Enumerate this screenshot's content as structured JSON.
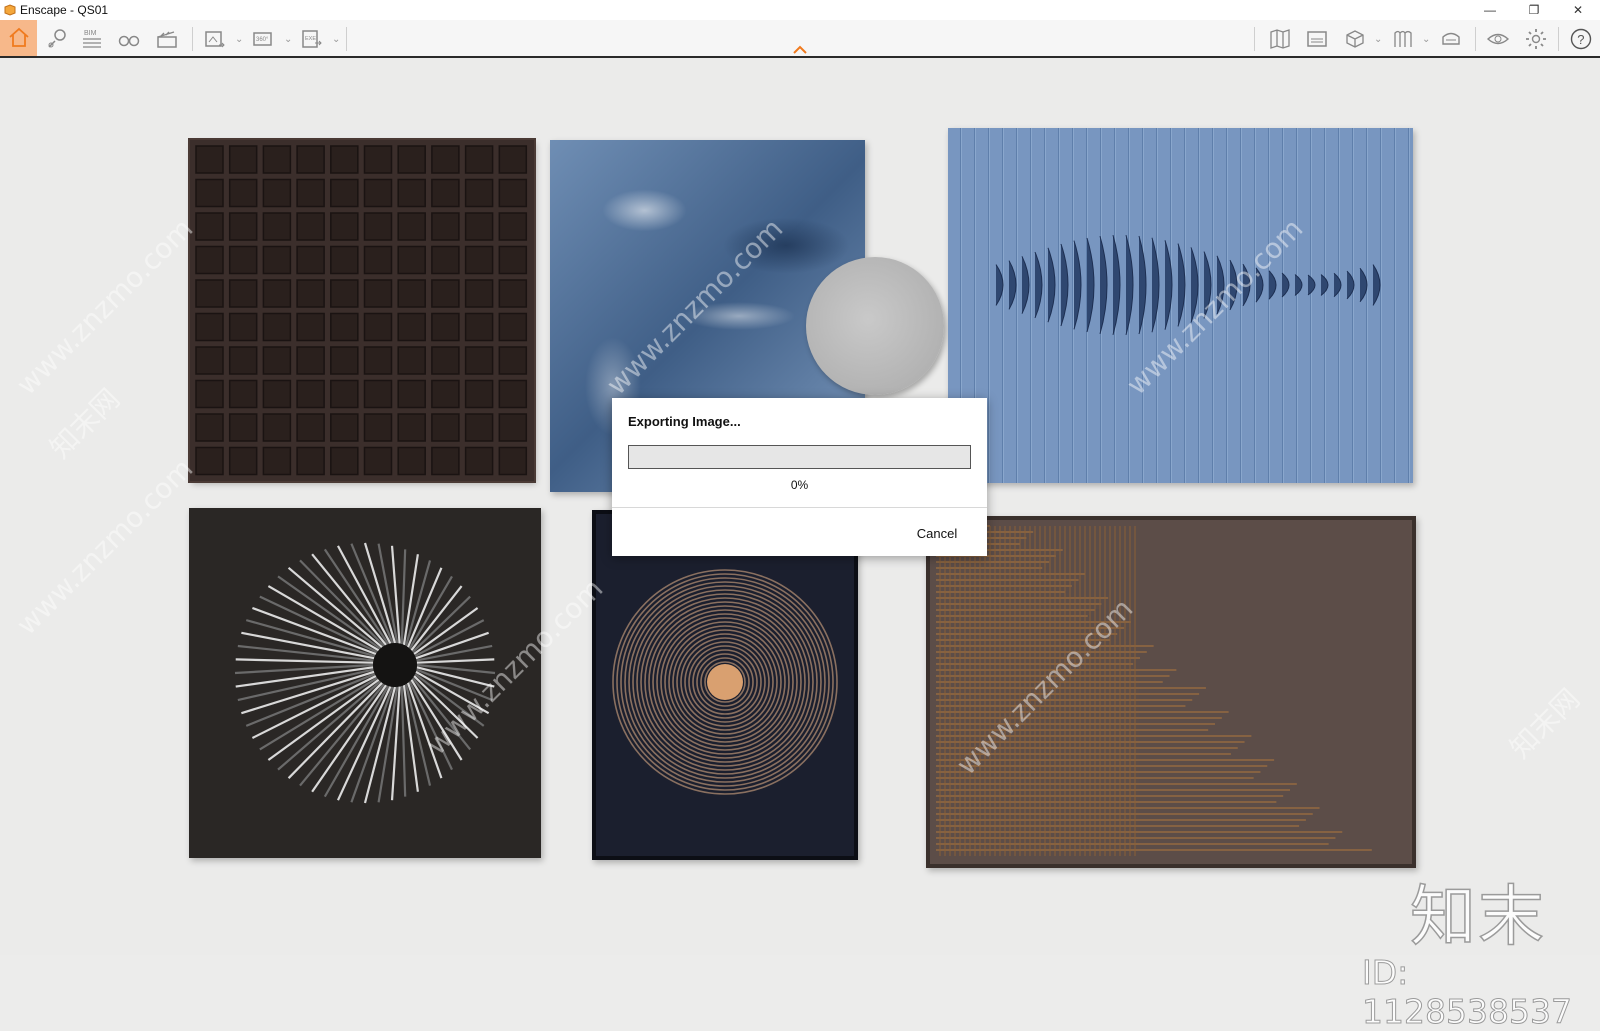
{
  "window": {
    "title": "Enscape - QS01"
  },
  "window_controls": {
    "minimize": "—",
    "restore": "❐",
    "close": "✕"
  },
  "toolbar": {
    "left": [
      {
        "name": "home-icon",
        "active": true
      },
      {
        "name": "views-icon"
      },
      {
        "name": "bim-icon",
        "label": "BIM"
      },
      {
        "name": "binoculars-icon"
      },
      {
        "name": "clapperboard-icon"
      },
      {
        "name": "render-image-icon",
        "dropdown": true
      },
      {
        "name": "panorama-360-icon",
        "label": "360°",
        "dropdown": true
      },
      {
        "name": "export-exe-icon",
        "label": "EXE",
        "dropdown": true
      }
    ],
    "right": [
      {
        "name": "map-icon"
      },
      {
        "name": "atmosphere-icon"
      },
      {
        "name": "cube-icon",
        "dropdown": true
      },
      {
        "name": "asset-library-icon",
        "dropdown": true
      },
      {
        "name": "vr-headset-icon"
      },
      {
        "name": "eye-icon"
      },
      {
        "name": "settings-gear-icon"
      },
      {
        "name": "help-icon"
      }
    ],
    "accent_color": "#f07a1e"
  },
  "dialog": {
    "title": "Exporting Image...",
    "progress_percent": 0,
    "progress_text": "0%",
    "cancel_label": "Cancel"
  },
  "watermark": {
    "brand": "知末",
    "id_text": "ID: 1128538537",
    "site": "www.znzmo.com",
    "site_cn": "知末网"
  }
}
